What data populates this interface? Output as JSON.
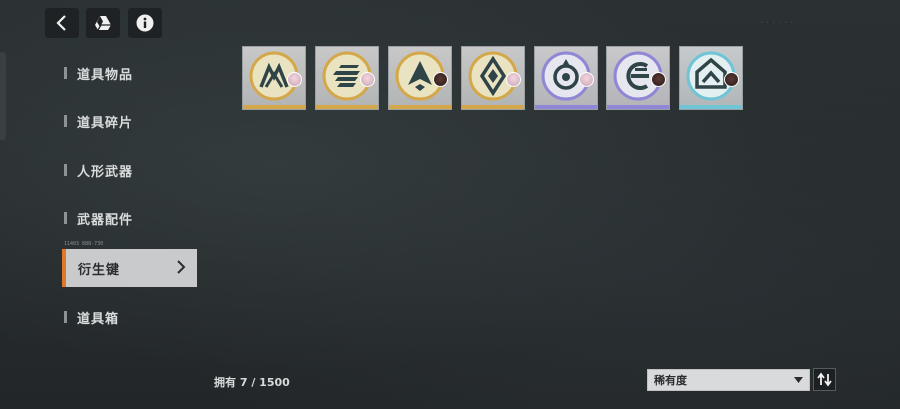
{
  "toolbar": {
    "back_icon": "chevron-left-icon",
    "drive_icon": "drive-icon",
    "info_icon": "info-icon"
  },
  "nav": {
    "items": [
      {
        "label": "道具物品"
      },
      {
        "label": "道具碎片"
      },
      {
        "label": "人形武器"
      },
      {
        "label": "武器配件"
      },
      {
        "label": "衍生键",
        "active": true
      },
      {
        "label": "道具箱"
      }
    ],
    "active_code": "11403 888-730"
  },
  "inventory": {
    "items": [
      {
        "rarity": "gold",
        "emblem": "mountain-emblem-icon",
        "badge": "pink-hair-avatar-icon"
      },
      {
        "rarity": "gold",
        "emblem": "stripes-emblem-icon",
        "badge": "pink-hair-avatar-icon"
      },
      {
        "rarity": "gold",
        "emblem": "arrow-emblem-icon",
        "badge": "dark-hair-avatar-icon"
      },
      {
        "rarity": "gold",
        "emblem": "diamond-emblem-icon",
        "badge": "pink-hair-avatar-icon"
      },
      {
        "rarity": "purple",
        "emblem": "ring-emblem-icon",
        "badge": "pink-hair-avatar-icon"
      },
      {
        "rarity": "purple",
        "emblem": "e-emblem-icon",
        "badge": "dark-hair-avatar-icon"
      },
      {
        "rarity": "blue",
        "emblem": "chevron-emblem-icon",
        "badge": "dark-hair-avatar-icon"
      }
    ],
    "colors": {
      "gold": "#d4a84a",
      "purple": "#8f86d6",
      "blue": "#6fc4d6"
    }
  },
  "footer": {
    "owned_text": "拥有 7 / 1500",
    "sort_value": "稀有度",
    "sort_order_icon": "sort-arrows-icon"
  }
}
